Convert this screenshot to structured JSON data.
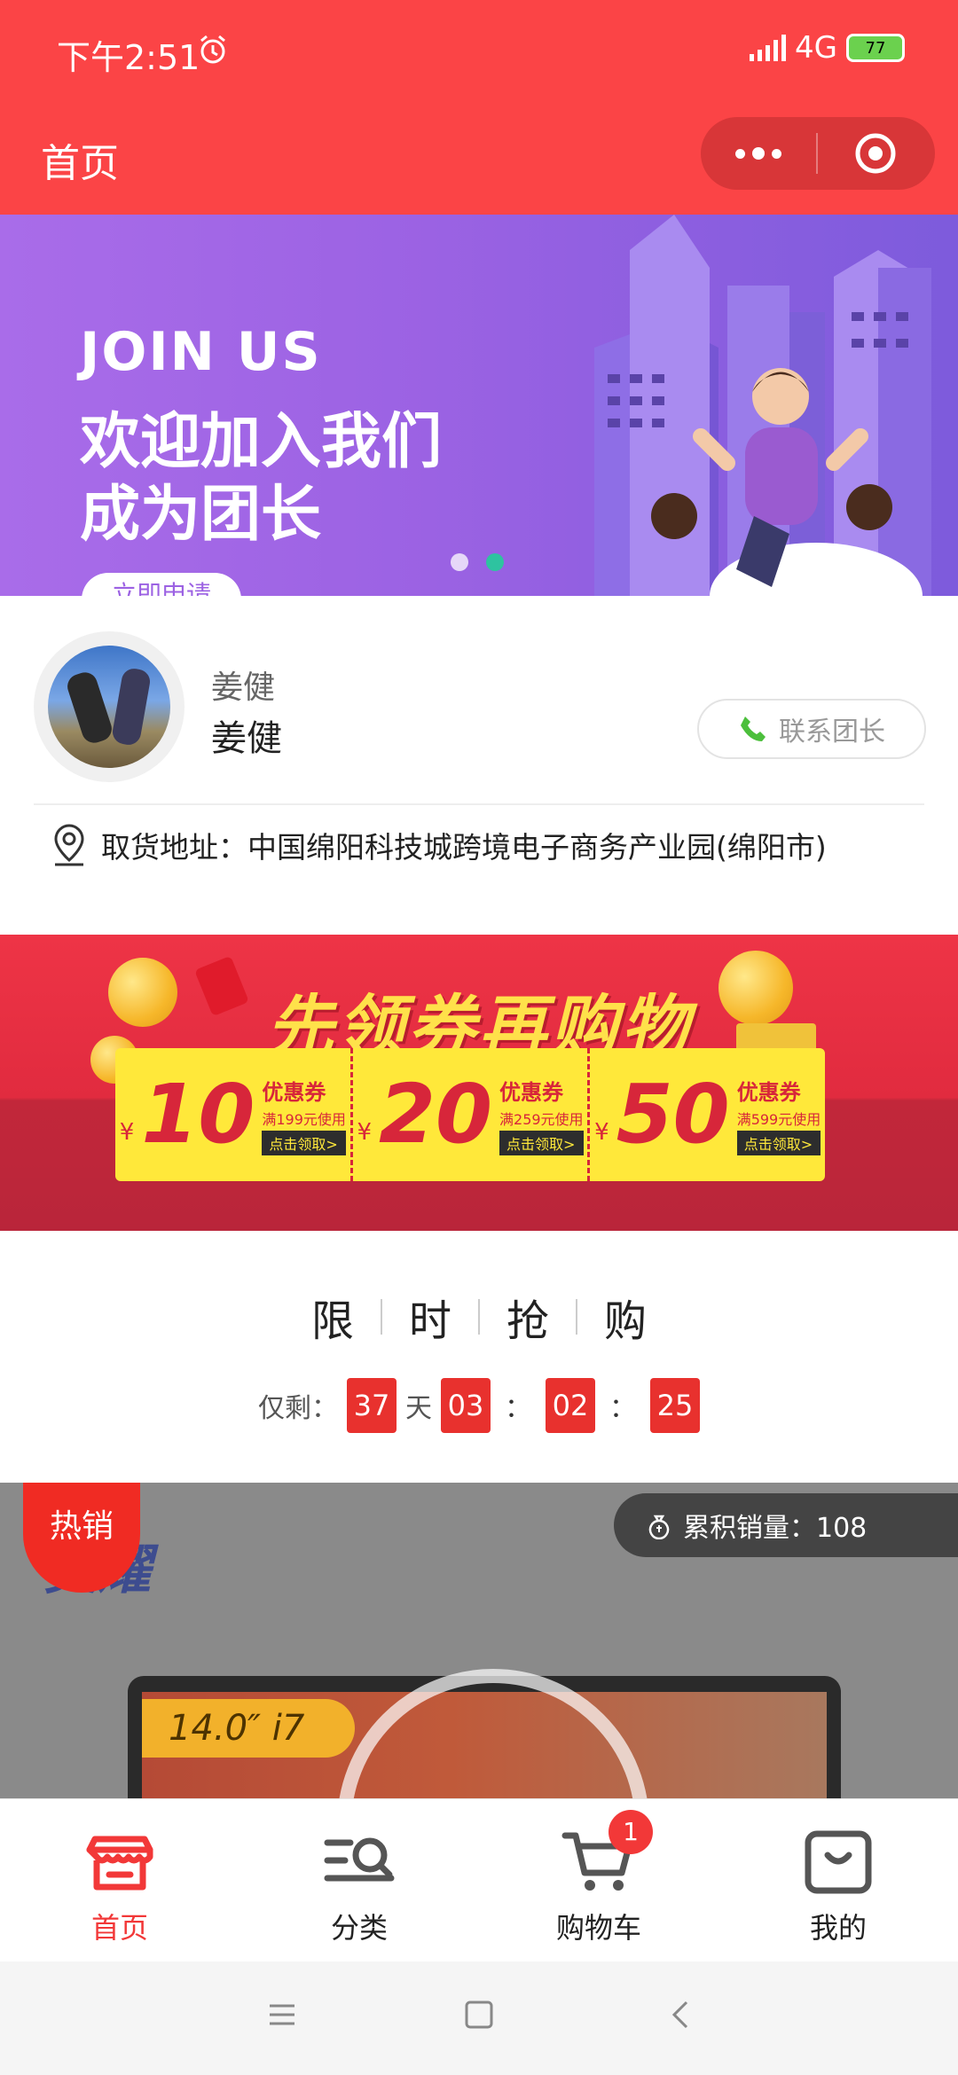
{
  "status_bar": {
    "time": "下午2:51",
    "network": "4G",
    "battery": "77"
  },
  "nav": {
    "title": "首页"
  },
  "banner": {
    "heading": "JOIN US",
    "line1": "欢迎加入我们",
    "line2": "成为团长",
    "apply_label": "立即申请",
    "slide_count": 2,
    "active_slide": 2
  },
  "leader": {
    "nickname": "姜健",
    "name": "姜健",
    "contact_label": "联系团长",
    "address": "取货地址：中国绵阳科技城跨境电子商务产业园(绵阳市)"
  },
  "coupon_banner": {
    "title": "先领券再购物",
    "coupons": [
      {
        "symbol": "¥",
        "amount": "10",
        "label": "优惠券",
        "condition": "满199元使用",
        "action": "点击领取>"
      },
      {
        "symbol": "¥",
        "amount": "20",
        "label": "优惠券",
        "condition": "满259元使用",
        "action": "点击领取>"
      },
      {
        "symbol": "¥",
        "amount": "50",
        "label": "优惠券",
        "condition": "满599元使用",
        "action": "点击领取>"
      }
    ]
  },
  "flash_sale": {
    "title_chars": [
      "限",
      "时",
      "抢",
      "购"
    ],
    "remaining_label": "仅剩：",
    "days": "37",
    "days_unit": "天",
    "hours": "03",
    "minutes": "02",
    "seconds": "25",
    "separator": "："
  },
  "product": {
    "hot_label": "热销",
    "sales_text": "累积销量：108",
    "brand_text": "灵耀",
    "spec_text": "14.0″ i7"
  },
  "tabbar": {
    "items": [
      {
        "label": "首页",
        "active": true
      },
      {
        "label": "分类",
        "active": false
      },
      {
        "label": "购物车",
        "active": false,
        "badge": "1"
      },
      {
        "label": "我的",
        "active": false
      }
    ]
  },
  "colors": {
    "primary": "#fb4446",
    "accent": "#f23838",
    "countdown": "#e8312e"
  }
}
